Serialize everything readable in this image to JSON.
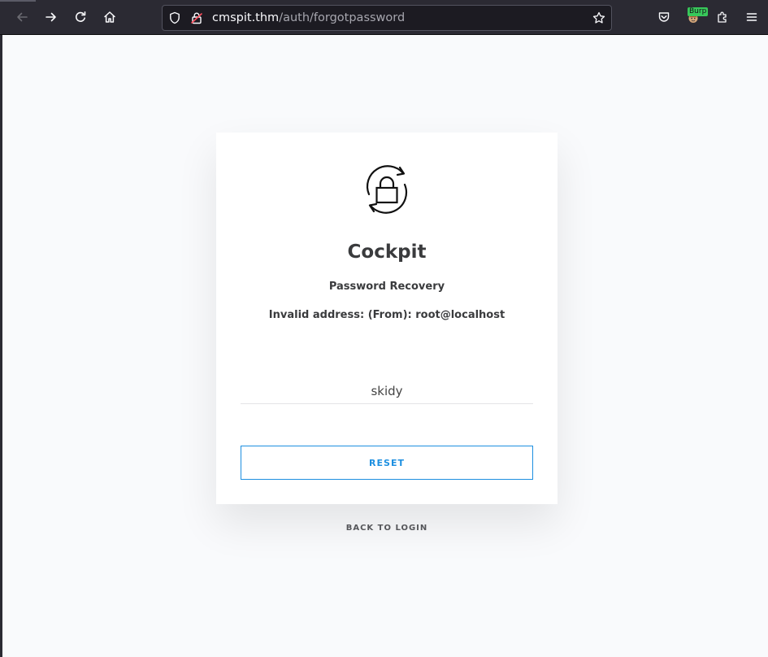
{
  "browser": {
    "url_host": "cmspit.thm",
    "url_path": "/auth/forgotpassword",
    "extension_badge": "Burp",
    "icons": {
      "back": "back-arrow-icon",
      "forward": "forward-arrow-icon",
      "reload": "reload-icon",
      "home": "home-icon",
      "tracking_protection": "shield-icon",
      "connection": "insecure-lock-icon",
      "bookmark": "star-icon",
      "pocket": "pocket-icon",
      "burp_extension": "burp-extension-icon",
      "extensions": "puzzle-icon",
      "menu": "hamburger-menu-icon"
    }
  },
  "card": {
    "logo_icon": "lock-refresh-icon",
    "title": "Cockpit",
    "subtitle": "Password Recovery",
    "error_message": "Invalid address: (From): root@localhost",
    "username_value": "skidy",
    "reset_label": "RESET"
  },
  "back_to_login": "BACK TO LOGIN",
  "colors": {
    "accent": "#1d8fe0",
    "toolbar_bg": "#2b2a33",
    "page_bg": "#f9fafc",
    "text": "#3a3b3d"
  }
}
